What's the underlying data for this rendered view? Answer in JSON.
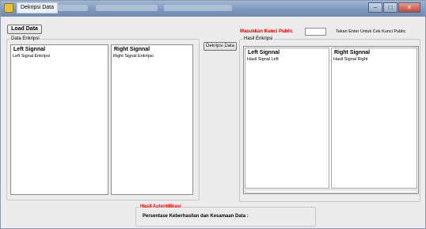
{
  "window": {
    "title": "Dekripsi Data",
    "caption_buttons": {
      "minimize": "–",
      "maximize": "□",
      "close": "✕"
    }
  },
  "toolbar": {
    "load_label": "Load Data"
  },
  "encrypted_group": {
    "title": "Data Enkripsi",
    "left_header": "Left Signnal",
    "left_item": "Left Signal Enkripsi",
    "right_header": "Right Signnal",
    "right_item": "Right Signal Enkripsi"
  },
  "decrypt_button": {
    "label": "Dekripsi Data"
  },
  "public_key": {
    "label": "Masukkan Kunci Public",
    "value": "",
    "hint": "Tekan Enter Untuk Cek Kunci Public"
  },
  "result_group": {
    "title": "Hasil Enkripsi",
    "left_header": "Left Signnal",
    "left_item": "Hasil Signal Left",
    "right_header": "Right Signnal",
    "right_item": "Hasil Signal Right"
  },
  "auth_group": {
    "title": "Hasil Autentifikasi",
    "label": "Persentase Keberhasilan dan Kesamaan Data :"
  },
  "colors": {
    "accent_red": "#ff0000",
    "titlebar": "#7e98bd"
  }
}
